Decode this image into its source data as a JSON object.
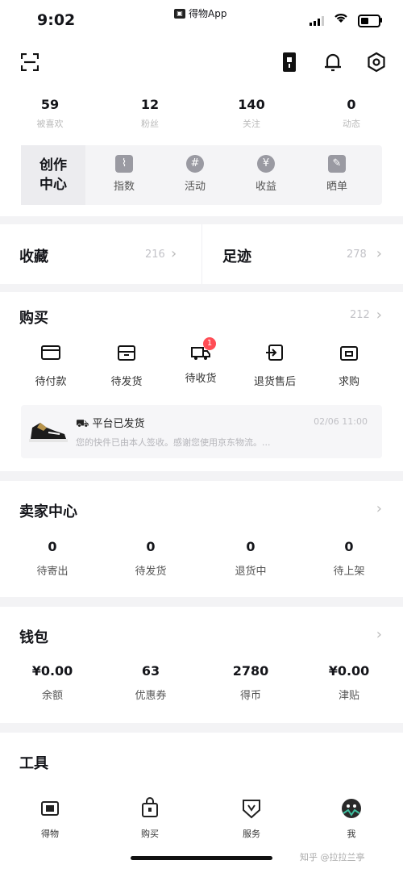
{
  "status_bar": {
    "time": "9:02",
    "app_label": "得物App"
  },
  "stats": [
    {
      "value": "59",
      "label": "被喜欢"
    },
    {
      "value": "12",
      "label": "粉丝"
    },
    {
      "value": "140",
      "label": "关注"
    },
    {
      "value": "0",
      "label": "动态"
    }
  ],
  "creator": {
    "title_line1": "创作",
    "title_line2": "中心",
    "items": [
      "指数",
      "活动",
      "收益",
      "晒单"
    ]
  },
  "collect": {
    "label": "收藏",
    "count": "216",
    "footprint_label": "足迹",
    "footprint_count": "278"
  },
  "buy": {
    "title": "购买",
    "count": "212",
    "items": [
      "待付款",
      "待发货",
      "待收货",
      "退货售后",
      "求购"
    ],
    "badge": "1",
    "order": {
      "title": "平台已发货",
      "date": "02/06 11:00",
      "desc": "您的快件已由本人签收。感谢您使用京东物流。..."
    }
  },
  "seller": {
    "title": "卖家中心",
    "items": [
      {
        "value": "0",
        "label": "待寄出"
      },
      {
        "value": "0",
        "label": "待发货"
      },
      {
        "value": "0",
        "label": "退货中"
      },
      {
        "value": "0",
        "label": "待上架"
      }
    ]
  },
  "wallet": {
    "title": "钱包",
    "items": [
      {
        "value": "¥0.00",
        "label": "余额"
      },
      {
        "value": "63",
        "label": "优惠券"
      },
      {
        "value": "2780",
        "label": "得币"
      },
      {
        "value": "¥0.00",
        "label": "津贴"
      }
    ]
  },
  "tools": {
    "title": "工具"
  },
  "tabbar": {
    "items": [
      "得物",
      "购买",
      "服务",
      "我"
    ]
  },
  "watermark": "知乎 @拉拉兰亭"
}
